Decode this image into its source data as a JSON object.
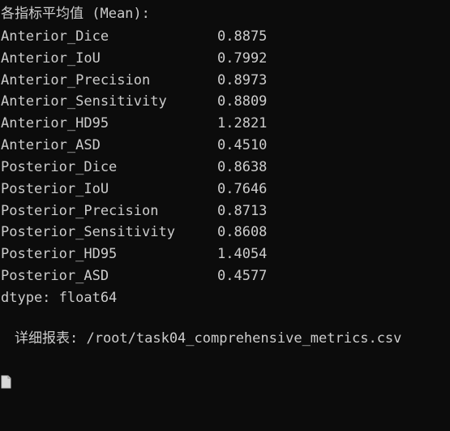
{
  "title": "各指标平均值 (Mean):",
  "metrics": [
    {
      "name": "Anterior_Dice",
      "value": "0.8875"
    },
    {
      "name": "Anterior_IoU",
      "value": "0.7992"
    },
    {
      "name": "Anterior_Precision",
      "value": "0.8973"
    },
    {
      "name": "Anterior_Sensitivity",
      "value": "0.8809"
    },
    {
      "name": "Anterior_HD95",
      "value": "1.2821"
    },
    {
      "name": "Anterior_ASD",
      "value": "0.4510"
    },
    {
      "name": "Posterior_Dice",
      "value": "0.8638"
    },
    {
      "name": "Posterior_IoU",
      "value": "0.7646"
    },
    {
      "name": "Posterior_Precision",
      "value": "0.8713"
    },
    {
      "name": "Posterior_Sensitivity",
      "value": "0.8608"
    },
    {
      "name": "Posterior_HD95",
      "value": "1.4054"
    },
    {
      "name": "Posterior_ASD",
      "value": "0.4577"
    }
  ],
  "dtype": "dtype: float64",
  "report": {
    "icon": "document-icon",
    "text": "详细报表: /root/task04_comprehensive_metrics.csv"
  },
  "colors": {
    "background": "#0c0c0c",
    "text": "#cccccc"
  }
}
